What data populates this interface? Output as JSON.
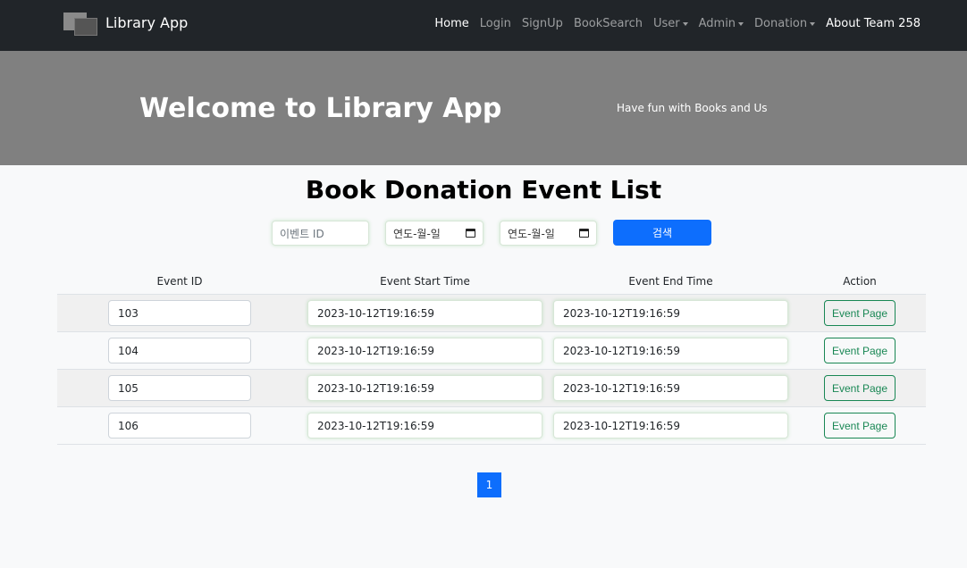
{
  "navbar": {
    "brand": "Library App",
    "links": [
      {
        "label": "Home",
        "active": true,
        "dropdown": false
      },
      {
        "label": "Login",
        "active": false,
        "dropdown": false
      },
      {
        "label": "SignUp",
        "active": false,
        "dropdown": false
      },
      {
        "label": "BookSearch",
        "active": false,
        "dropdown": false
      },
      {
        "label": "User",
        "active": false,
        "dropdown": true
      },
      {
        "label": "Admin",
        "active": false,
        "dropdown": true
      },
      {
        "label": "Donation",
        "active": false,
        "dropdown": true
      },
      {
        "label": "About Team 258",
        "active": true,
        "dropdown": false
      }
    ]
  },
  "hero": {
    "title": "Welcome to Library App",
    "subtitle": "Have fun with Books and Us"
  },
  "page": {
    "title": "Book Donation Event List"
  },
  "search": {
    "id_placeholder": "이벤트 ID",
    "start_date_placeholder": "연도-월-일",
    "end_date_placeholder": "연도-월-일",
    "button_label": "검색"
  },
  "table": {
    "headers": {
      "id": "Event ID",
      "start": "Event Start Time",
      "end": "Event End Time",
      "action": "Action"
    },
    "rows": [
      {
        "id": "103",
        "start": "2023-10-12T19:16:59",
        "end": "2023-10-12T19:16:59",
        "action": "Event Page"
      },
      {
        "id": "104",
        "start": "2023-10-12T19:16:59",
        "end": "2023-10-12T19:16:59",
        "action": "Event Page"
      },
      {
        "id": "105",
        "start": "2023-10-12T19:16:59",
        "end": "2023-10-12T19:16:59",
        "action": "Event Page"
      },
      {
        "id": "106",
        "start": "2023-10-12T19:16:59",
        "end": "2023-10-12T19:16:59",
        "action": "Event Page"
      }
    ]
  },
  "pagination": {
    "current": "1"
  },
  "colors": {
    "navbar_bg": "#212529",
    "hero_bg": "#808080",
    "primary": "#0d6efd",
    "success": "#198754"
  }
}
